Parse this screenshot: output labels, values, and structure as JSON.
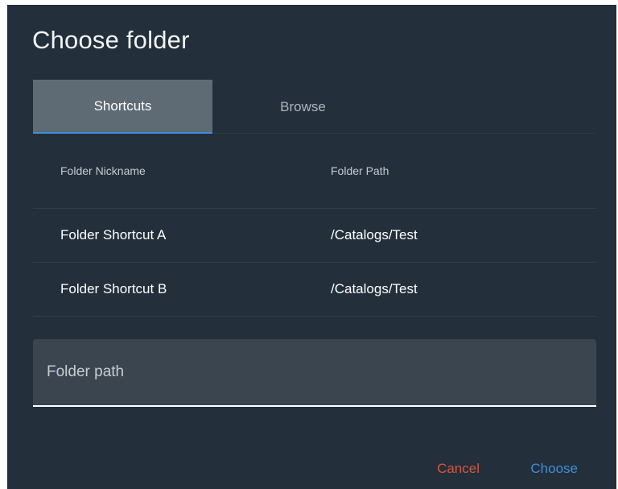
{
  "dialog": {
    "title": "Choose folder"
  },
  "tabs": [
    {
      "label": "Shortcuts",
      "active": true
    },
    {
      "label": "Browse",
      "active": false
    }
  ],
  "table": {
    "columns": [
      "Folder Nickname",
      "Folder Path"
    ],
    "rows": [
      {
        "nickname": "Folder Shortcut A",
        "path": "/Catalogs/Test"
      },
      {
        "nickname": "Folder Shortcut B",
        "path": "/Catalogs/Test"
      }
    ]
  },
  "path_input": {
    "value": "",
    "placeholder": "Folder path"
  },
  "actions": {
    "cancel_label": "Cancel",
    "choose_label": "Choose"
  },
  "colors": {
    "background": "#232f3a",
    "active_tab": "#5e6a74",
    "tab_indicator": "#3d8fd8",
    "cancel": "#d7553f",
    "choose": "#3f8fd6"
  }
}
